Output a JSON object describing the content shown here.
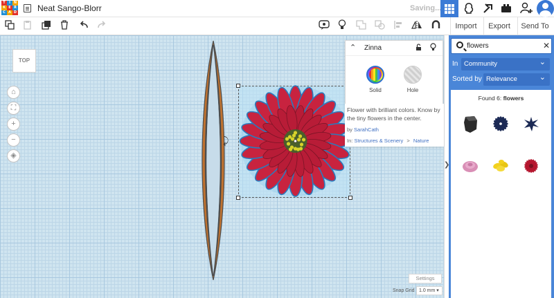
{
  "app": {
    "logo_letters": [
      "T",
      "I",
      "N",
      "K",
      "E",
      "R",
      "C",
      "A",
      "D"
    ],
    "design_title": "Neat Sango-Blorr",
    "save_status": "Saving..."
  },
  "toolbar": {
    "import_label": "Import",
    "export_label": "Export",
    "sendto_label": "Send To"
  },
  "viewcube": {
    "label": "TOP"
  },
  "inspector": {
    "shape_name": "Zinna",
    "solid_label": "Solid",
    "hole_label": "Hole"
  },
  "shape_info": {
    "description": "Flower with brilliant colors. Know by the tiny flowers in the center.",
    "author_prefix": "by ",
    "author": "SarahCath",
    "category_prefix": "In: ",
    "category": "Structures & Scenery",
    "separator": ">",
    "subcategory": "Nature"
  },
  "workplane": {
    "settings_label": "Settings",
    "snap_grid_label": "Snap Grid",
    "snap_grid_value": "1.0 mm ▾"
  },
  "library": {
    "search_value": "flowers",
    "in_label": "In",
    "in_value": "Community",
    "sort_label": "Sorted by",
    "sort_value": "Relevance",
    "found_prefix": "Found 6: ",
    "found_query": "flowers",
    "results": [
      {
        "name": "dark-block",
        "color": "#2b2b2b"
      },
      {
        "name": "navy-disc-flower",
        "color": "#1c2a55"
      },
      {
        "name": "navy-star-flower",
        "color": "#1c2a55"
      },
      {
        "name": "pink-rose",
        "color": "#d98fb6"
      },
      {
        "name": "yellow-flower",
        "color": "#f2d11e"
      },
      {
        "name": "red-daisy",
        "color": "#b5162e"
      }
    ]
  },
  "colors": {
    "accent": "#3b7bd6",
    "panel_blue": "#4a86d8",
    "petal_red": "#c8233f",
    "petal_outline": "#2a7bbd",
    "center_yellow": "#d7d22a",
    "stick_outline": "#4d4d4d",
    "stick_orange": "#c0722f"
  }
}
